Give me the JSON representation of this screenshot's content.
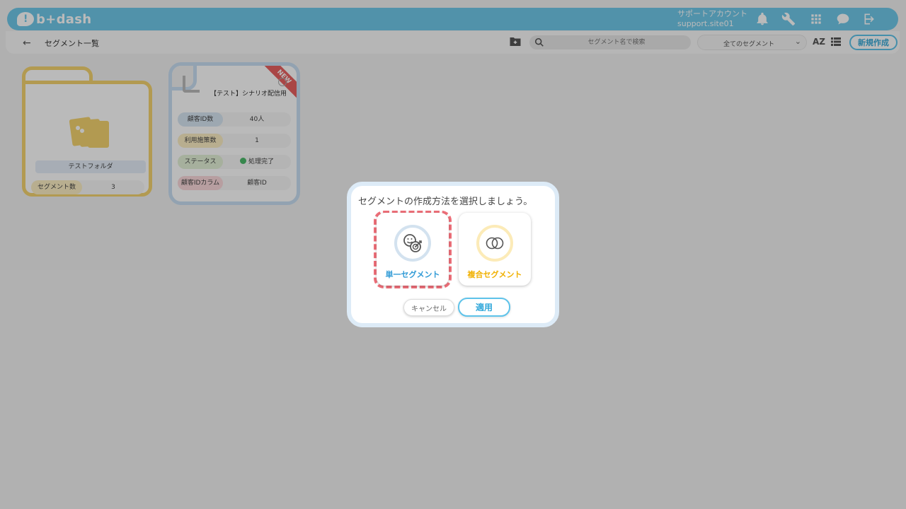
{
  "header": {
    "logo_text": "b+dash",
    "account_name": "サポートアカウント",
    "account_id": "support.site01",
    "icons": [
      "bell-icon",
      "wrench-icon",
      "apps-grid-icon",
      "chat-help-icon",
      "logout-icon"
    ],
    "brand_color": "#6fc9ea"
  },
  "subheader": {
    "title": "セグメント一覧",
    "search_placeholder": "セグメント名で検索",
    "filter_value": "全てのセグメント",
    "sort_label": "AZ",
    "new_button": "新規作成"
  },
  "cards": {
    "folder": {
      "name": "テストフォルダ",
      "count_label": "セグメント数",
      "count_value": "3"
    },
    "segment": {
      "badge": "NEW",
      "title": "【テスト】シナリオ配信用",
      "rows": [
        {
          "label": "顧客ID数",
          "value": "40人"
        },
        {
          "label": "利用施策数",
          "value": "1"
        },
        {
          "label": "ステータス",
          "value": "処理完了"
        },
        {
          "label": "顧客IDカラム",
          "value": "顧客ID"
        }
      ]
    }
  },
  "modal": {
    "title": "セグメントの作成方法を選択しましょう。",
    "options": [
      {
        "label": "単一セグメント",
        "icon": "face-target-icon",
        "selected": true
      },
      {
        "label": "複合セグメント",
        "icon": "venn-circles-icon",
        "selected": false
      }
    ],
    "cancel": "キャンセル",
    "apply": "適用"
  }
}
